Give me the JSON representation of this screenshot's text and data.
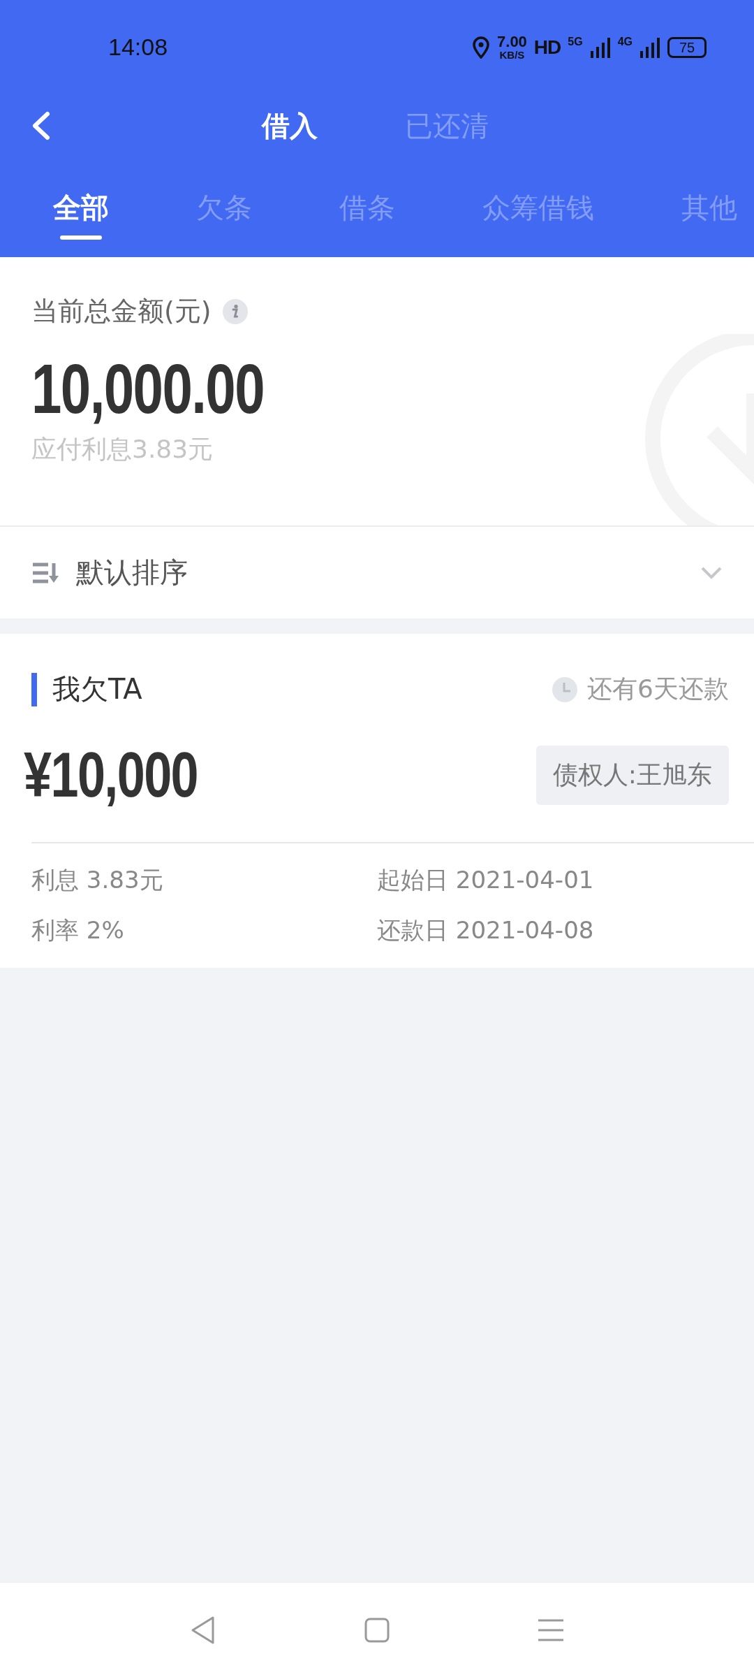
{
  "status_bar": {
    "time": "14:08",
    "speed_value": "7.00",
    "speed_unit": "KB/S",
    "hd": "HD",
    "network_5g": "5G",
    "network_4g": "4G",
    "battery": "75"
  },
  "header_tabs": [
    {
      "label": "借入",
      "selected": true
    },
    {
      "label": "已还清",
      "selected": false
    }
  ],
  "category_tabs": [
    {
      "label": "全部",
      "selected": true
    },
    {
      "label": "欠条",
      "selected": false
    },
    {
      "label": "借条",
      "selected": false
    },
    {
      "label": "众筹借钱",
      "selected": false
    },
    {
      "label": "其他",
      "selected": false
    }
  ],
  "summary": {
    "label": "当前总金额(元)",
    "amount": "10,000.00",
    "interest": "应付利息3.83元"
  },
  "sort": {
    "label": "默认排序"
  },
  "loans": [
    {
      "title": "我欠TA",
      "due_text": "还有6天还款",
      "amount": "¥10,000",
      "creditor": "债权人:王旭东",
      "interest": "利息 3.83元",
      "rate": "利率 2%",
      "start": "起始日 2021-04-01",
      "due": "还款日 2021-04-08"
    }
  ]
}
